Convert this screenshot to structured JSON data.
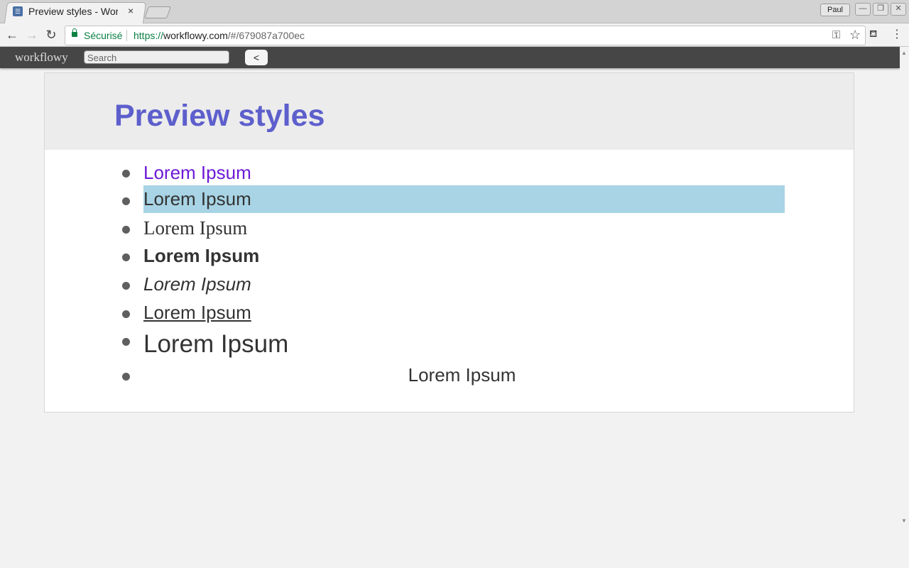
{
  "browser": {
    "tab_title": "Preview styles - Workflowy",
    "tab_close": "×",
    "user": "Paul",
    "window_buttons": [
      "—",
      "❐",
      "✕"
    ],
    "secure_label": "Sécurisé",
    "url_scheme": "https://",
    "url_host": "workflowy.com",
    "url_path": "/#/679087a700ec"
  },
  "icons": {
    "back": "←",
    "forward": "→",
    "reload": "↻",
    "key": "⚿",
    "star": "☆",
    "extension": "⛾",
    "menu": "⋮",
    "scroll_up": "▲",
    "scroll_down": "▼"
  },
  "app": {
    "logo": "workflowy",
    "search_placeholder": "Search",
    "back_button": "<"
  },
  "page": {
    "title": "Preview styles",
    "items": [
      {
        "text": "Lorem Ipsum",
        "style": "colored"
      },
      {
        "text": "Lorem Ipsum",
        "style": "highlighted"
      },
      {
        "text": "Lorem Ipsum",
        "style": "serif"
      },
      {
        "text": "Lorem Ipsum",
        "style": "bold"
      },
      {
        "text": "Lorem Ipsum",
        "style": "italic"
      },
      {
        "text": "Lorem Ipsum ",
        "style": "underline"
      },
      {
        "text": "Lorem Ipsum",
        "style": "large"
      },
      {
        "text": "Lorem Ipsum",
        "style": "centered"
      }
    ]
  },
  "colors": {
    "title": "#5d5fcc",
    "colored_text": "#6d1ad6",
    "highlight": "#a8d4e5",
    "header_bar": "#464646"
  }
}
